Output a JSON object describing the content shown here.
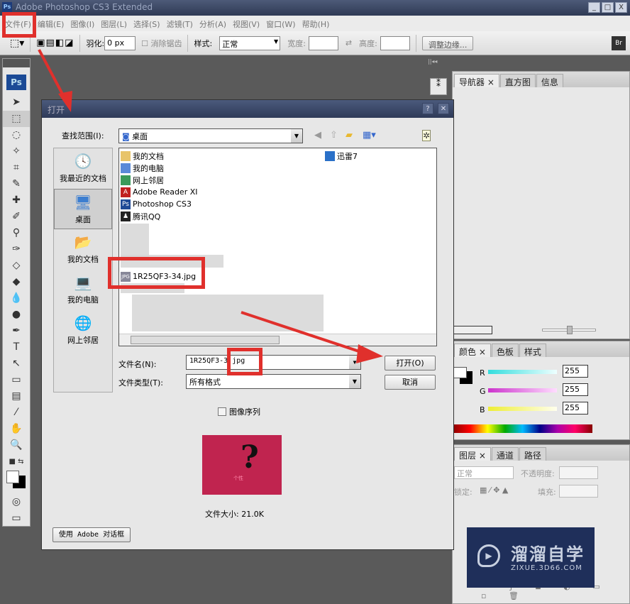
{
  "app": {
    "title": "Adobe Photoshop CS3 Extended",
    "logo": "Ps",
    "window_buttons": [
      "_",
      "□",
      "X"
    ]
  },
  "menu": [
    "文件(F)",
    "编辑(E)",
    "图像(I)",
    "图层(L)",
    "选择(S)",
    "滤镜(T)",
    "分析(A)",
    "视图(V)",
    "窗口(W)",
    "帮助(H)"
  ],
  "options": {
    "feather_label": "羽化:",
    "feather_value": "0 px",
    "antialias_label": "消除锯齿",
    "style_label": "样式:",
    "style_value": "正常",
    "width_label": "宽度:",
    "height_label": "高度:",
    "refine_edge": "调整边缘..."
  },
  "toolbox": {
    "logo": "Ps"
  },
  "dialog": {
    "title": "打开",
    "help": "?",
    "close": "✕",
    "look_in_label": "查找范围(I):",
    "look_in_value": "桌面",
    "places": [
      "我最近的文档",
      "桌面",
      "我的文档",
      "我的电脑",
      "网上邻居"
    ],
    "files": [
      "我的文档",
      "我的电脑",
      "网上邻居",
      "Adobe Reader XI",
      "Photoshop CS3",
      "腾讯QQ",
      "1R25QF3-34.jpg",
      "迅雷7"
    ],
    "filename_label": "文件名(N):",
    "filename_value": "1R25QF3-3",
    "filename_ext": "jpg",
    "filetype_label": "文件类型(T):",
    "filetype_value": "所有格式",
    "open_button": "打开(O)",
    "cancel_button": "取消",
    "image_sequence": "图像序列",
    "preview_caption": "个性",
    "file_size": "文件大小: 21.0K",
    "use_adobe_dialog": "使用 Adobe 对话框"
  },
  "panels": {
    "nav_tabs": [
      "导航器",
      "直方图",
      "信息"
    ],
    "color_tabs": [
      "颜色",
      "色板",
      "样式"
    ],
    "color": {
      "r_label": "R",
      "g_label": "G",
      "b_label": "B",
      "r": "255",
      "g": "255",
      "b": "255"
    },
    "layer_tabs": [
      "图层",
      "通道",
      "路径"
    ],
    "blend_mode": "正常",
    "opacity_label": "不透明度:",
    "lock_label": "锁定:",
    "fill_label": "填充:"
  },
  "watermark": {
    "name": "溜溜自学",
    "url": "ZIXUE.3D66.COM"
  },
  "colors": {
    "annotation_red": "#e0302c",
    "dialog_title": "#3a4868",
    "preview_bg": "#c0244f"
  }
}
